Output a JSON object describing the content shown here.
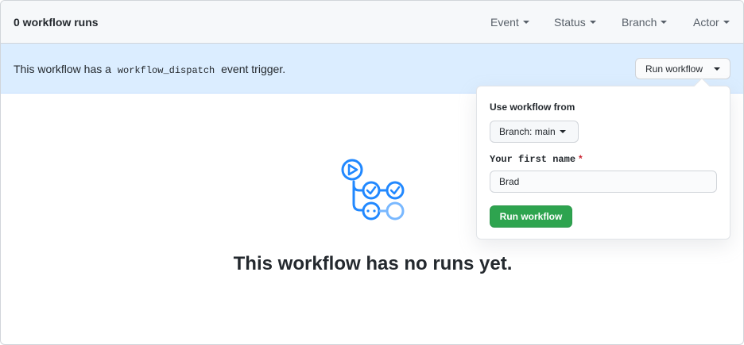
{
  "header": {
    "runs_count": "0 workflow runs",
    "filters": {
      "event": "Event",
      "status": "Status",
      "branch": "Branch",
      "actor": "Actor"
    }
  },
  "banner": {
    "text_before": "This workflow has a",
    "code": "workflow_dispatch",
    "text_after": "event trigger.",
    "run_button_label": "Run workflow"
  },
  "popover": {
    "use_label": "Use workflow from",
    "branch_label": "Branch: main",
    "field_label": "Your first name",
    "required_marker": "*",
    "field_value": "Brad",
    "submit_label": "Run workflow"
  },
  "empty_state": {
    "icon": "workflow-icon",
    "title": "This workflow has no runs yet."
  },
  "colors": {
    "accent_blue": "#2188ff",
    "light_blue": "#79b8ff",
    "banner_bg": "#dbedff",
    "green": "#2ea44f",
    "required_red": "#cb2431"
  }
}
